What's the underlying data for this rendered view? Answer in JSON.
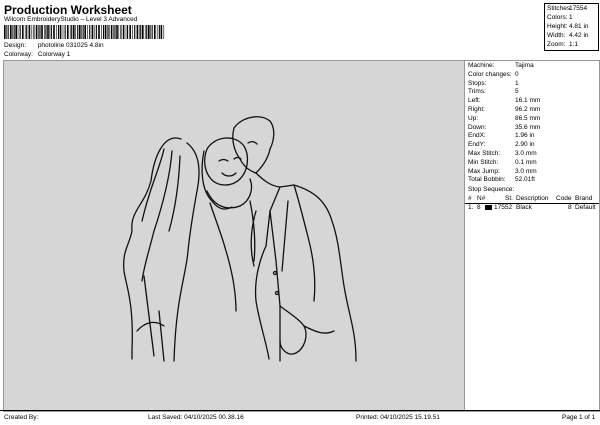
{
  "header": {
    "title": "Production Worksheet",
    "subtitle": "Wilcom EmbroideryStudio – Level 3 Advanced"
  },
  "meta": {
    "design_label": "Design:",
    "design_value": "photoline 031025 4.8in",
    "colorway_label": "Colorway:",
    "colorway_value": "Colorway 1"
  },
  "stats": [
    {
      "label": "Stitches:",
      "value": "17554"
    },
    {
      "label": "Colors:",
      "value": "1"
    },
    {
      "label": "Height:",
      "value": "4.81 in"
    },
    {
      "label": "Width:",
      "value": "4.42 in"
    },
    {
      "label": "Zoom:",
      "value": "1:1"
    }
  ],
  "panel": {
    "rows": [
      {
        "label": "Machine:",
        "value": "Tajima"
      },
      {
        "label": "Color changes:",
        "value": "0"
      },
      {
        "label": "Stops:",
        "value": "1"
      },
      {
        "label": "Trims:",
        "value": "5"
      },
      {
        "label": "Left:",
        "value": "16.1 mm"
      },
      {
        "label": "Right:",
        "value": "96.2 mm"
      },
      {
        "label": "Up:",
        "value": "86.5 mm"
      },
      {
        "label": "Down:",
        "value": "35.6 mm"
      },
      {
        "label": "EndX:",
        "value": "1.96 in"
      },
      {
        "label": "EndY:",
        "value": "2.90 in"
      },
      {
        "label": "Max Stitch:",
        "value": "3.0 mm"
      },
      {
        "label": "Min Stitch:",
        "value": "0.1 mm"
      },
      {
        "label": "Max Jump:",
        "value": "3.0 mm"
      },
      {
        "label": "Total Bobbin:",
        "value": "52.01ft"
      }
    ],
    "stop_sequence_title": "Stop Sequence:",
    "columns": {
      "num": "#",
      "n": "N#",
      "st": "St.",
      "description": "Description",
      "code": "Code",
      "brand": "Brand"
    },
    "stops": [
      {
        "num": "1.",
        "n": "8",
        "st": "17552",
        "description": "Black",
        "code": "8",
        "brand": "Default",
        "color": "#000000"
      }
    ]
  },
  "footer": {
    "created_by": "Created By:",
    "last_saved": "Last Saved: 04/10/2025 00.38.16",
    "printed": "Printed: 04/10/2025 15.19.51",
    "page": "Page 1 of 1"
  }
}
